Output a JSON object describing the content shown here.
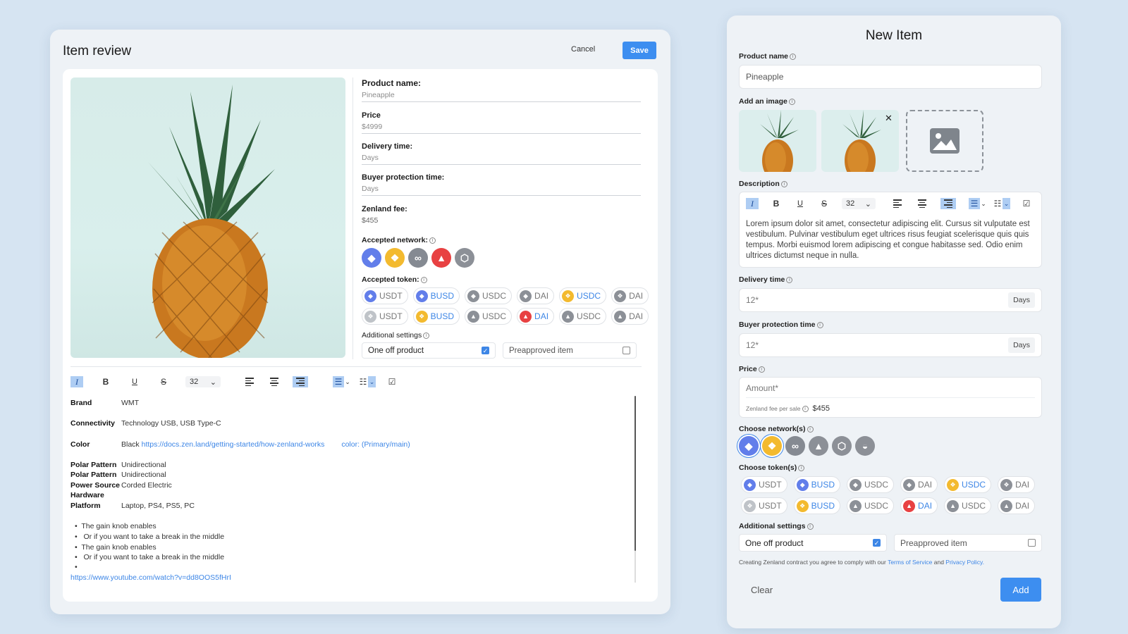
{
  "left": {
    "title": "Item review",
    "cancel": "Cancel",
    "save": "Save",
    "fields": [
      {
        "label": "Product name:",
        "value": "Pineapple"
      },
      {
        "label": "Price",
        "value": "$4999"
      },
      {
        "label": "Delivery time:",
        "value": "Days"
      },
      {
        "label": "Buyer protection time:",
        "value": "Days"
      },
      {
        "label": "Zenland fee:",
        "value": "$455"
      }
    ],
    "accepted_network_label": "Accepted network:",
    "accepted_token_label": "Accepted token:",
    "tokens_row1": [
      "USDT",
      "BUSD",
      "USDC",
      "DAI",
      "USDC",
      "DAI"
    ],
    "tokens_row2": [
      "USDT",
      "BUSD",
      "USDC",
      "DAI",
      "USDC",
      "DAI"
    ],
    "additional_label": "Additional settings",
    "one_off": "One off product",
    "preapproved": "Preapproved item",
    "toolbar": {
      "italic": "I",
      "bold": "B",
      "underline": "U",
      "strike": "S",
      "size": "32"
    },
    "desc": {
      "brand_k": "Brand",
      "brand_v": "WMT",
      "conn_k": "Connectivity",
      "conn_v": "Technology USB, USB Type-C",
      "color_k": "Color",
      "color_v": "Black",
      "color_link": "https://docs.zen.land/getting-started/how-zenland-works",
      "color_note": "color: (Primary/main)",
      "polar1_k": "Polar Pattern",
      "polar1_v": "Unidirectional",
      "polar2_k": "Polar Pattern",
      "polar2_v": "Unidirectional",
      "power_k": "Power Source",
      "power_v": "Corded Electric",
      "hw_k": "Hardware",
      "plat_k": "Platform",
      "plat_v": "Laptop, PS4, PS5, PC",
      "b1": "The gain knob enables",
      "b2": "Or if you want to take a break in the middle",
      "b3": "The gain knob enables",
      "b4": "Or if you want to take a break in the middle",
      "yt": "https://www.youtube.com/watch?v=dd8OOS5fHrI"
    }
  },
  "right": {
    "title": "New Item",
    "product_name_label": "Product name",
    "product_name_value": "Pineapple",
    "add_image_label": "Add an image",
    "description_label": "Description",
    "toolbar_size": "32",
    "description_text": "Lorem ipsum dolor sit amet, consectetur adipiscing elit. Cursus sit vulputate est vestibulum. Pulvinar vestibulum eget ultrices risus feugiat scelerisque quis quis tempus. Morbi euismod lorem adipiscing et congue habitasse sed. Odio enim ultrices dictumst neque in nulla.",
    "delivery_label": "Delivery time",
    "delivery_placeholder": "12*",
    "delivery_suffix": "Days",
    "buyer_label": "Buyer protection time",
    "buyer_placeholder": "12*",
    "buyer_suffix": "Days",
    "price_label": "Price",
    "price_placeholder": "Amount*",
    "fee_label": "Zenland fee per sale",
    "fee_value": "$455",
    "network_label": "Choose network(s)",
    "token_label": "Choose token(s)",
    "tokens_row1": [
      "USDT",
      "BUSD",
      "USDC",
      "DAI",
      "USDC",
      "DAI"
    ],
    "tokens_row2": [
      "USDT",
      "BUSD",
      "USDC",
      "DAI",
      "USDC",
      "DAI"
    ],
    "additional_label": "Additional settings",
    "one_off": "One off product",
    "preapproved": "Preapproved item",
    "terms_prefix": "Creating Zenland contract you agree to comply with our",
    "terms_link": "Terms of Service",
    "terms_and": "and",
    "privacy_link": "Privacy Policy.",
    "clear": "Clear",
    "add": "Add"
  },
  "colors": {
    "accent": "#3d8ef0",
    "eth": "#627eea",
    "bnb": "#f3ba2f",
    "avax": "#e84142",
    "gray": "#8c9097"
  }
}
